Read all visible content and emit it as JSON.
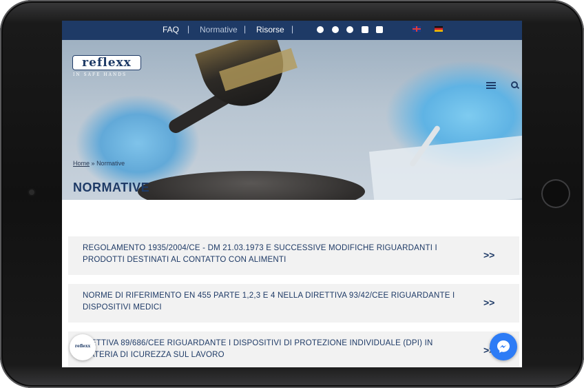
{
  "topbar": {
    "faq": "FAQ",
    "normative": "Normative",
    "risorse": "Risorse",
    "separator": "|"
  },
  "logo": {
    "name": "reflexx",
    "tagline": "IN SAFE HANDS"
  },
  "breadcrumb": {
    "home": "Home",
    "separator": "»",
    "current": "Normative"
  },
  "page": {
    "title": "NORMATIVE"
  },
  "items": [
    {
      "text": "REGOLAMENTO 1935/2004/CE - DM 21.03.1973 E SUCCESSIVE MODIFICHE RIGUARDANTI I PRODOTTI DESTINATI AL CONTATTO CON ALIMENTI",
      "arrow": ">>"
    },
    {
      "text": "NORME DI RIFERIMENTO EN 455 PARTE 1,2,3 E 4 NELLA DIRETTIVA 93/42/CEE RIGUARDANTE I DISPOSITIVI MEDICI",
      "arrow": ">>"
    },
    {
      "text": "IRETTIVA 89/686/CEE RIGUARDANTE I DISPOSITIVI DI PROTEZIONE INDIVIDUALE (DPI) IN MATERIA DI ICUREZZA SUL LAVORO",
      "arrow": ">>"
    }
  ],
  "chat": {
    "bubble_label": "reflexx"
  },
  "colors": {
    "brand_navy": "#1e3a66",
    "messenger_blue": "#2d7cf6",
    "item_bg": "#f2f2f2"
  },
  "icons": [
    "facebook-icon",
    "instagram-icon",
    "twitter-icon",
    "linkedin-icon",
    "youtube-icon",
    "uk-flag-icon",
    "de-flag-icon",
    "menu-icon",
    "search-icon",
    "messenger-icon"
  ]
}
